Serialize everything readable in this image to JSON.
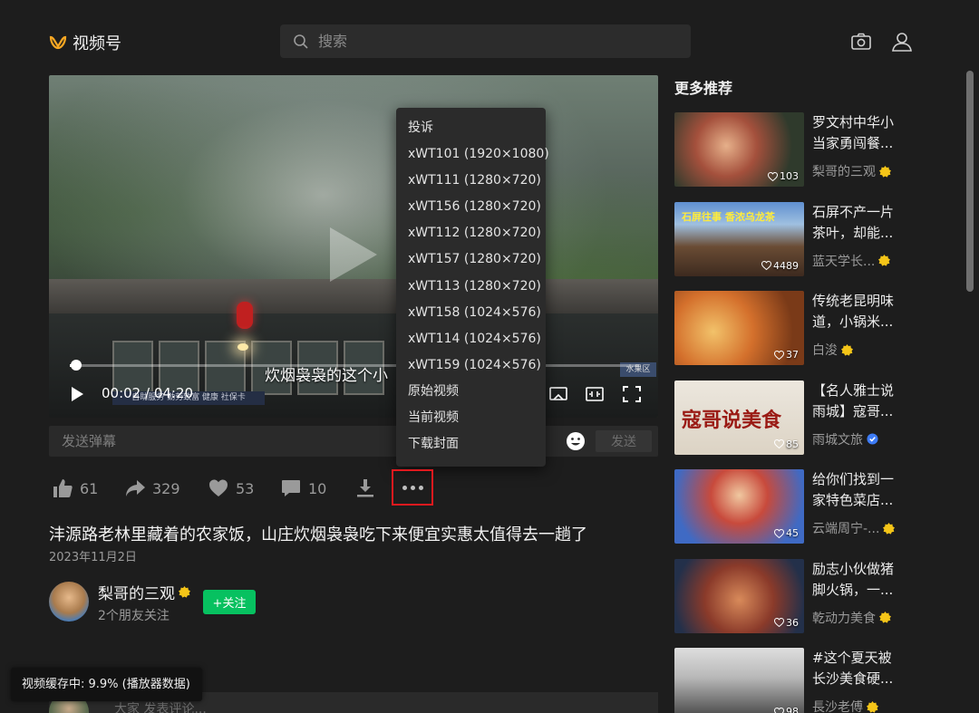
{
  "header": {
    "app_name": "视频号",
    "search_placeholder": "搜索",
    "icons": [
      "camera-icon",
      "user-icon"
    ]
  },
  "player": {
    "subtitle": "炊烟袅袅的这个小",
    "time": "00:02 / 04:20",
    "progress": 0.008,
    "sign_small": "水果区",
    "sign_banner": "自助服务 勤劳致富 健康 社保卡"
  },
  "danmu": {
    "placeholder": "发送弹幕",
    "send_label": "发送"
  },
  "context_menu": {
    "items": [
      "投诉",
      "xWT101 (1920×1080)",
      "xWT111 (1280×720)",
      "xWT156 (1280×720)",
      "xWT112 (1280×720)",
      "xWT157 (1280×720)",
      "xWT113 (1280×720)",
      "xWT158 (1024×576)",
      "xWT114 (1024×576)",
      "xWT159 (1024×576)",
      "原始视频",
      "当前视频",
      "下载封面"
    ]
  },
  "actions": {
    "like": "61",
    "share": "329",
    "favorite": "53",
    "comment": "10"
  },
  "video": {
    "title": "沣源路老林里藏着的农家饭，山庄炊烟袅袅吃下来便宜实惠太值得去一趟了",
    "date": "2023年11月2日"
  },
  "author": {
    "name": "梨哥的三观",
    "sub": "2个朋友关注",
    "follow_label": "+关注"
  },
  "toast": "视频缓存中: 9.9% (播放器数据)",
  "comment": {
    "placeholder": "大家 发表评论..."
  },
  "sidebar": {
    "title": "更多推荐",
    "items": [
      {
        "title": "罗文村中华小当家勇闯餐...",
        "author": "梨哥的三观",
        "count": "103",
        "badge": "gold",
        "thumb_text": ""
      },
      {
        "title": "石屏不产一片茶叶，却能...",
        "author": "蓝天学长...",
        "count": "4489",
        "badge": "gold",
        "thumb_text": "石屏往事 香浓乌龙茶"
      },
      {
        "title": "传统老昆明味道，小锅米...",
        "author": "白浚",
        "count": "37",
        "badge": "gold",
        "thumb_text": ""
      },
      {
        "title": "【名人雅士说雨城】寇哥...",
        "author": "雨城文旅",
        "count": "85",
        "badge": "blue",
        "thumb_text": "寇哥说美食"
      },
      {
        "title": "给你们找到一家特色菜店...",
        "author": "云端周宁-...",
        "count": "45",
        "badge": "gold",
        "thumb_text": ""
      },
      {
        "title": "励志小伙做猪脚火锅，一...",
        "author": "乾动力美食",
        "count": "36",
        "badge": "gold",
        "thumb_text": ""
      },
      {
        "title": "#这个夏天被长沙美食硬...",
        "author": "長沙老傅",
        "count": "98",
        "badge": "gold",
        "thumb_text": ""
      }
    ]
  },
  "colors": {
    "background": "#1d1d1d",
    "accent_green": "#07c160",
    "highlight_red": "#e0191e",
    "badge_gold": "#f5c518",
    "badge_blue": "#3d7bf5"
  }
}
